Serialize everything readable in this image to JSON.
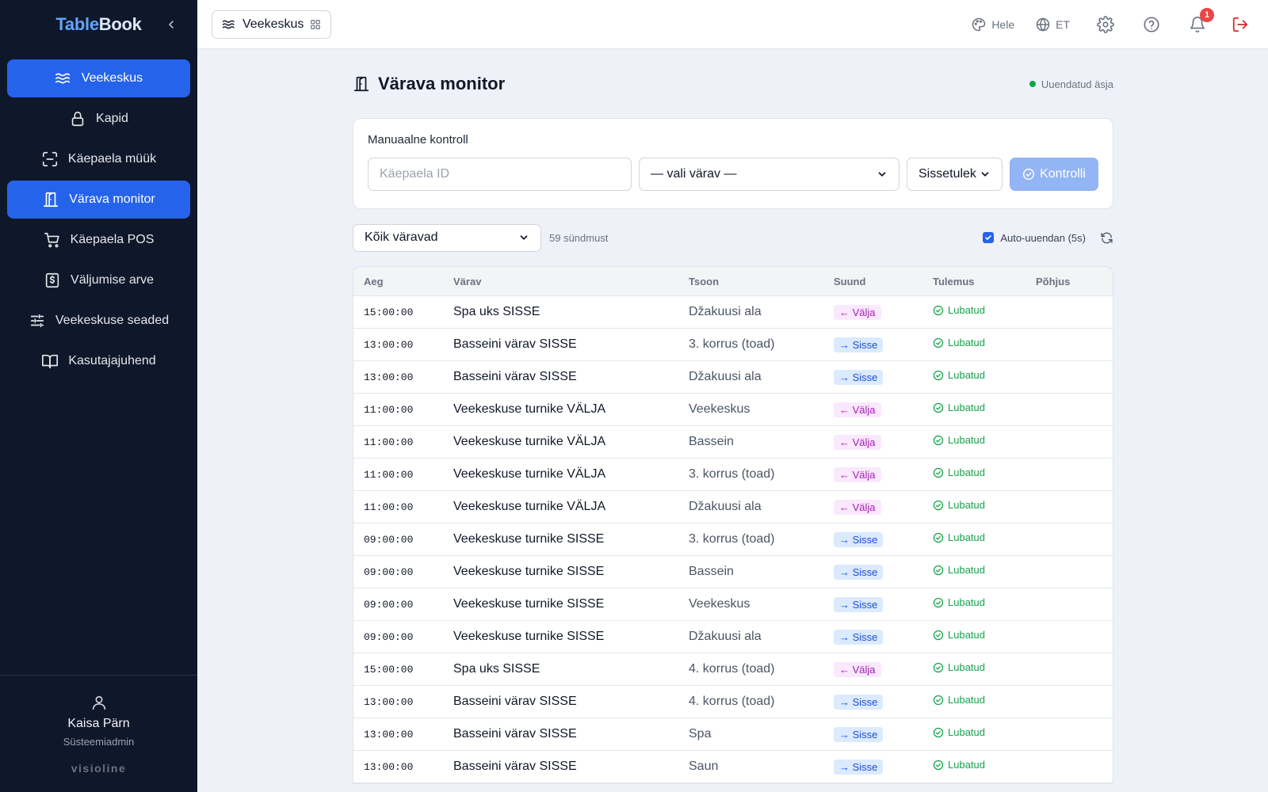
{
  "brand": {
    "part1": "Table",
    "part2": "Book"
  },
  "sidebar": {
    "items": [
      {
        "label": "Veekeskus",
        "icon": "waves-icon",
        "active": true
      },
      {
        "label": "Kapid",
        "icon": "lock-icon",
        "active": false
      },
      {
        "label": "Käepaela müük",
        "icon": "scan-icon",
        "active": false
      },
      {
        "label": "Värava monitor",
        "icon": "door-icon",
        "active": true
      },
      {
        "label": "Käepaela POS",
        "icon": "cart-icon",
        "active": false
      },
      {
        "label": "Väljumise arve",
        "icon": "receipt-icon",
        "active": false
      },
      {
        "label": "Veekeskuse seaded",
        "icon": "sliders-icon",
        "active": false
      },
      {
        "label": "Kasutajajuhend",
        "icon": "book-icon",
        "active": false
      }
    ],
    "user": {
      "name": "Kaisa Pärn",
      "role": "Süsteemiadmin"
    },
    "vendor": "visioline"
  },
  "topbar": {
    "module": "Veekeskus",
    "theme_label": "Hele",
    "lang_label": "ET",
    "notification_count": "1"
  },
  "page": {
    "title": "Värava monitor",
    "status": "Uuendatud äsja"
  },
  "manual": {
    "title": "Manuaalne kontroll",
    "wristband_placeholder": "Käepaela ID",
    "gate_select": "— vali värav —",
    "direction_select": "Sissetulek",
    "check_button": "Kontrolli"
  },
  "filter": {
    "gate_filter": "Kõik väravad",
    "count": "59 sündmust",
    "auto_refresh_label": "Auto-uuendan (5s)",
    "auto_refresh_checked": true
  },
  "table": {
    "headers": [
      "Aeg",
      "Värav",
      "Tsoon",
      "Suund",
      "Tulemus",
      "Põhjus"
    ],
    "rows": [
      {
        "time": "15:00:00",
        "gate": "Spa uks SISSE",
        "zone": "Džakuusi ala",
        "dir": "← Välja",
        "dir_type": "out",
        "result": "Lubatud",
        "reason": ""
      },
      {
        "time": "13:00:00",
        "gate": "Basseini värav SISSE",
        "zone": "3. korrus (toad)",
        "dir": "→ Sisse",
        "dir_type": "in",
        "result": "Lubatud",
        "reason": ""
      },
      {
        "time": "13:00:00",
        "gate": "Basseini värav SISSE",
        "zone": "Džakuusi ala",
        "dir": "→ Sisse",
        "dir_type": "in",
        "result": "Lubatud",
        "reason": ""
      },
      {
        "time": "11:00:00",
        "gate": "Veekeskuse turnike VÄLJA",
        "zone": "Veekeskus",
        "dir": "← Välja",
        "dir_type": "out",
        "result": "Lubatud",
        "reason": ""
      },
      {
        "time": "11:00:00",
        "gate": "Veekeskuse turnike VÄLJA",
        "zone": "Bassein",
        "dir": "← Välja",
        "dir_type": "out",
        "result": "Lubatud",
        "reason": ""
      },
      {
        "time": "11:00:00",
        "gate": "Veekeskuse turnike VÄLJA",
        "zone": "3. korrus (toad)",
        "dir": "← Välja",
        "dir_type": "out",
        "result": "Lubatud",
        "reason": ""
      },
      {
        "time": "11:00:00",
        "gate": "Veekeskuse turnike VÄLJA",
        "zone": "Džakuusi ala",
        "dir": "← Välja",
        "dir_type": "out",
        "result": "Lubatud",
        "reason": ""
      },
      {
        "time": "09:00:00",
        "gate": "Veekeskuse turnike SISSE",
        "zone": "3. korrus (toad)",
        "dir": "→ Sisse",
        "dir_type": "in",
        "result": "Lubatud",
        "reason": ""
      },
      {
        "time": "09:00:00",
        "gate": "Veekeskuse turnike SISSE",
        "zone": "Bassein",
        "dir": "→ Sisse",
        "dir_type": "in",
        "result": "Lubatud",
        "reason": ""
      },
      {
        "time": "09:00:00",
        "gate": "Veekeskuse turnike SISSE",
        "zone": "Veekeskus",
        "dir": "→ Sisse",
        "dir_type": "in",
        "result": "Lubatud",
        "reason": ""
      },
      {
        "time": "09:00:00",
        "gate": "Veekeskuse turnike SISSE",
        "zone": "Džakuusi ala",
        "dir": "→ Sisse",
        "dir_type": "in",
        "result": "Lubatud",
        "reason": ""
      },
      {
        "time": "15:00:00",
        "gate": "Spa uks SISSE",
        "zone": "4. korrus (toad)",
        "dir": "← Välja",
        "dir_type": "out",
        "result": "Lubatud",
        "reason": ""
      },
      {
        "time": "13:00:00",
        "gate": "Basseini värav SISSE",
        "zone": "4. korrus (toad)",
        "dir": "→ Sisse",
        "dir_type": "in",
        "result": "Lubatud",
        "reason": ""
      },
      {
        "time": "13:00:00",
        "gate": "Basseini värav SISSE",
        "zone": "Spa",
        "dir": "→ Sisse",
        "dir_type": "in",
        "result": "Lubatud",
        "reason": ""
      },
      {
        "time": "13:00:00",
        "gate": "Basseini värav SISSE",
        "zone": "Saun",
        "dir": "→ Sisse",
        "dir_type": "in",
        "result": "Lubatud",
        "reason": ""
      }
    ]
  },
  "colors": {
    "sidebar_bg": "#0f172a",
    "accent": "#2563eb",
    "success": "#16a34a",
    "out_badge": "#fae8ff",
    "in_badge": "#dbeafe",
    "danger": "#ef4444"
  }
}
